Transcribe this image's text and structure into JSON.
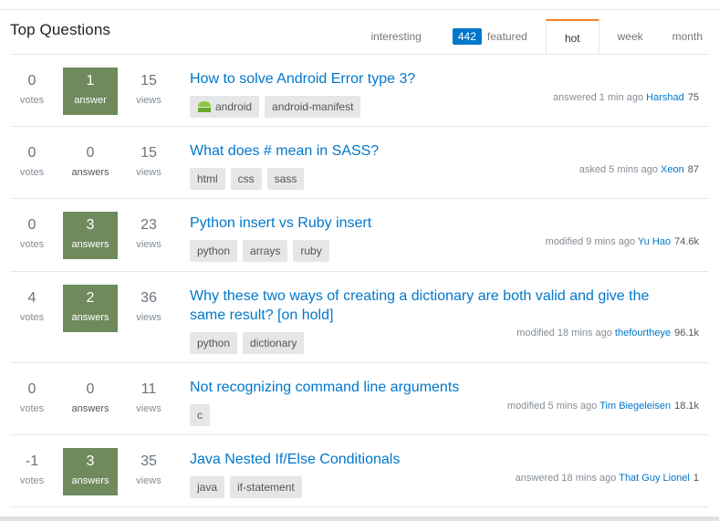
{
  "header": {
    "title": "Top Questions",
    "tabs": {
      "interesting": "interesting",
      "featured_count": "442",
      "featured": "featured",
      "hot": "hot",
      "week": "week",
      "month": "month"
    },
    "active_tab": "hot"
  },
  "colors": {
    "link": "#0077cc",
    "accepted_answer_bg": "#6f8a5c",
    "bounty_bg": "#0077cc",
    "active_tab_accent": "#f48024"
  },
  "questions": [
    {
      "votes": "0",
      "votes_label": "votes",
      "answers": "1",
      "answers_label": "answer",
      "has_accepted": true,
      "views": "15",
      "views_label": "views",
      "title": "How to solve Android Error type 3?",
      "tags": [
        "android",
        "android-manifest"
      ],
      "tag_icons": [
        "android-icon",
        ""
      ],
      "action": "answered 1 min ago",
      "user": "Harshad",
      "rep": "75"
    },
    {
      "votes": "0",
      "votes_label": "votes",
      "answers": "0",
      "answers_label": "answers",
      "has_accepted": false,
      "views": "15",
      "views_label": "views",
      "title": "What does # mean in SASS?",
      "tags": [
        "html",
        "css",
        "sass"
      ],
      "action": "asked 5 mins ago",
      "user": "Xeon",
      "rep": "87"
    },
    {
      "votes": "0",
      "votes_label": "votes",
      "answers": "3",
      "answers_label": "answers",
      "has_accepted": true,
      "views": "23",
      "views_label": "views",
      "title": "Python insert vs Ruby insert",
      "tags": [
        "python",
        "arrays",
        "ruby"
      ],
      "action": "modified 9 mins ago",
      "user": "Yu Hao",
      "rep": "74.6k"
    },
    {
      "votes": "4",
      "votes_label": "votes",
      "answers": "2",
      "answers_label": "answers",
      "has_accepted": true,
      "views": "36",
      "views_label": "views",
      "title": "Why these two ways of creating a dictionary are both valid and give the same result? [on hold]",
      "tags": [
        "python",
        "dictionary"
      ],
      "action": "modified 18 mins ago",
      "user": "thefourtheye",
      "rep": "96.1k"
    },
    {
      "votes": "0",
      "votes_label": "votes",
      "answers": "0",
      "answers_label": "answers",
      "has_accepted": false,
      "views": "11",
      "views_label": "views",
      "title": "Not recognizing command line arguments",
      "tags": [
        "c"
      ],
      "action": "modified 5 mins ago",
      "user": "Tim Biegeleisen",
      "rep": "18.1k"
    },
    {
      "votes": "-1",
      "votes_label": "votes",
      "answers": "3",
      "answers_label": "answers",
      "has_accepted": true,
      "views": "35",
      "views_label": "views",
      "title": "Java Nested If/Else Conditionals",
      "tags": [
        "java",
        "if-statement"
      ],
      "action": "answered 18 mins ago",
      "user": "That Guy Lionel",
      "rep": "1"
    }
  ]
}
